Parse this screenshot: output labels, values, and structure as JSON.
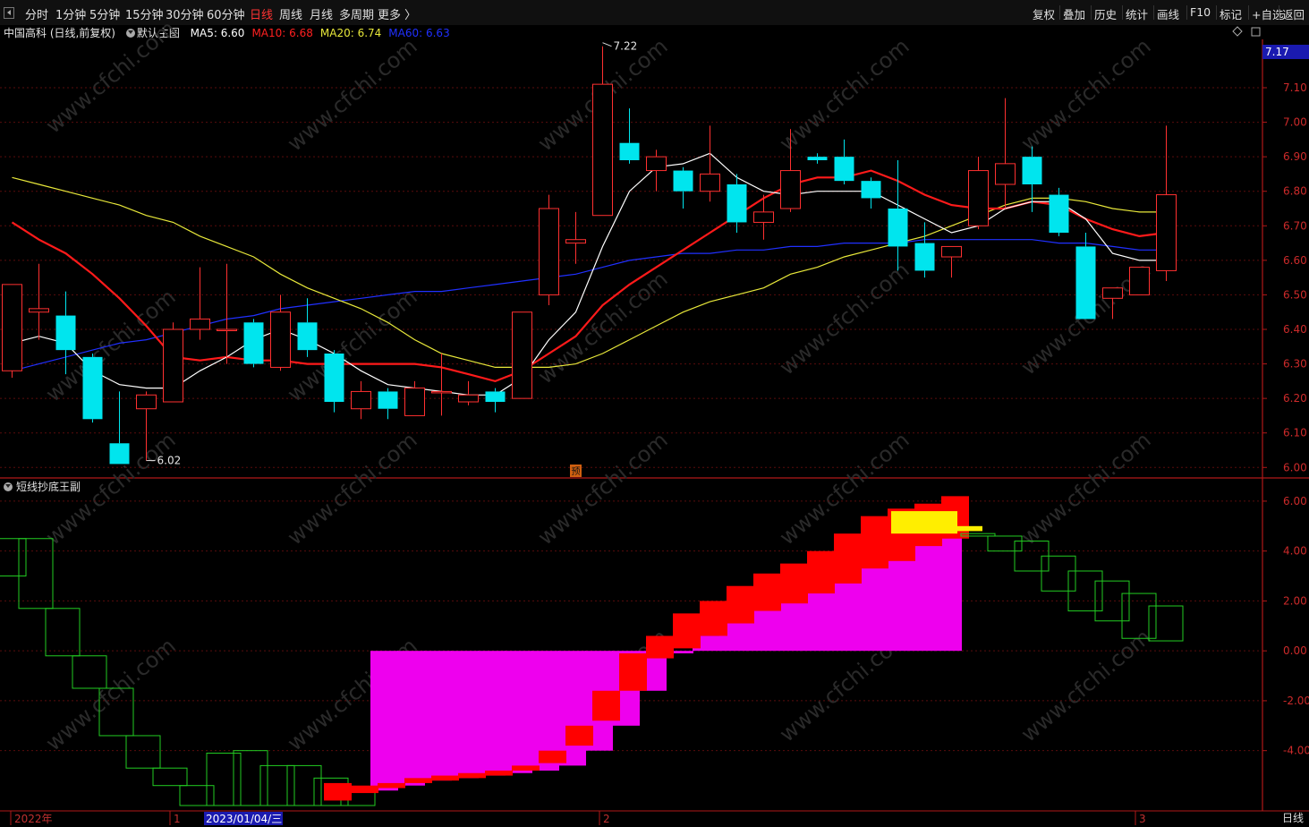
{
  "toolbar": {
    "periods": [
      {
        "label": "分时",
        "active": false
      },
      {
        "label": "1分钟",
        "active": false
      },
      {
        "label": "5分钟",
        "active": false
      },
      {
        "label": "15分钟",
        "active": false
      },
      {
        "label": "30分钟",
        "active": false
      },
      {
        "label": "60分钟",
        "active": false
      },
      {
        "label": "日线",
        "active": true
      },
      {
        "label": "周线",
        "active": false
      },
      {
        "label": "月线",
        "active": false
      },
      {
        "label": "多周期",
        "active": false
      },
      {
        "label": "更多 〉",
        "active": false
      }
    ],
    "right_buttons": [
      "复权",
      "叠加",
      "历史",
      "统计",
      "画线",
      "F10",
      "标记",
      "+自选",
      "返回"
    ]
  },
  "main": {
    "title": "中国高科 (日线,前复权)",
    "template": "默认主图",
    "ma_labels": [
      {
        "text": "MA5: 6.60",
        "color": "#ffffff"
      },
      {
        "text": "MA10: 6.68",
        "color": "#ff2020"
      },
      {
        "text": "MA20: 6.74",
        "color": "#e8e83a"
      },
      {
        "text": "MA60: 6.63",
        "color": "#2030ff"
      }
    ]
  },
  "sub": {
    "title": "短线抄底王副"
  },
  "period_label": "日线",
  "colors": {
    "up": "#ff3030",
    "down": "#00e5ee",
    "ma5": "#ffffff",
    "ma10": "#ff1a1a",
    "ma20": "#e8e83a",
    "ma60": "#2030ff",
    "axis": "#b01818",
    "green": "#22cc22",
    "magenta": "#ee00ee",
    "red": "#ff0000",
    "yellow": "#ffee00"
  },
  "watermark": "www.cfchi.com",
  "chart_data": [
    {
      "type": "candlestick",
      "ylim": [
        5.98,
        7.24
      ],
      "yticks": [
        "7.10",
        "7.00",
        "6.90",
        "6.80",
        "6.70",
        "6.60",
        "6.50",
        "6.40",
        "6.30",
        "6.20",
        "6.10",
        "6.00"
      ],
      "current_price": "7.17",
      "high_annotation": "7.22",
      "low_annotation": "6.02",
      "marker": "预",
      "candles": [
        {
          "o": 6.28,
          "c": 6.53,
          "h": 6.53,
          "l": 6.26
        },
        {
          "o": 6.45,
          "c": 6.46,
          "h": 6.59,
          "l": 6.37
        },
        {
          "o": 6.44,
          "c": 6.34,
          "h": 6.51,
          "l": 6.27
        },
        {
          "o": 6.32,
          "c": 6.14,
          "h": 6.33,
          "l": 6.13
        },
        {
          "o": 6.07,
          "c": 6.01,
          "h": 6.22,
          "l": 6.01
        },
        {
          "o": 6.17,
          "c": 6.21,
          "h": 6.22,
          "l": 6.02
        },
        {
          "o": 6.19,
          "c": 6.4,
          "h": 6.42,
          "l": 6.19
        },
        {
          "o": 6.4,
          "c": 6.43,
          "h": 6.58,
          "l": 6.37
        },
        {
          "o": 6.4,
          "c": 6.4,
          "h": 6.59,
          "l": 6.3
        },
        {
          "o": 6.42,
          "c": 6.3,
          "h": 6.43,
          "l": 6.29
        },
        {
          "o": 6.29,
          "c": 6.45,
          "h": 6.5,
          "l": 6.28
        },
        {
          "o": 6.42,
          "c": 6.34,
          "h": 6.49,
          "l": 6.32
        },
        {
          "o": 6.33,
          "c": 6.19,
          "h": 6.34,
          "l": 6.16
        },
        {
          "o": 6.17,
          "c": 6.22,
          "h": 6.25,
          "l": 6.14
        },
        {
          "o": 6.22,
          "c": 6.17,
          "h": 6.23,
          "l": 6.14
        },
        {
          "o": 6.15,
          "c": 6.23,
          "h": 6.25,
          "l": 6.15
        },
        {
          "o": 6.22,
          "c": 6.22,
          "h": 6.33,
          "l": 6.15
        },
        {
          "o": 6.19,
          "c": 6.21,
          "h": 6.25,
          "l": 6.18
        },
        {
          "o": 6.22,
          "c": 6.19,
          "h": 6.23,
          "l": 6.16
        },
        {
          "o": 6.2,
          "c": 6.45,
          "h": 6.45,
          "l": 6.2
        },
        {
          "o": 6.5,
          "c": 6.75,
          "h": 6.79,
          "l": 6.47
        },
        {
          "o": 6.65,
          "c": 6.66,
          "h": 6.74,
          "l": 6.59
        },
        {
          "o": 6.73,
          "c": 7.11,
          "h": 7.22,
          "l": 6.73
        },
        {
          "o": 6.94,
          "c": 6.89,
          "h": 7.04,
          "l": 6.88
        },
        {
          "o": 6.86,
          "c": 6.9,
          "h": 6.92,
          "l": 6.8
        },
        {
          "o": 6.86,
          "c": 6.8,
          "h": 6.87,
          "l": 6.75
        },
        {
          "o": 6.8,
          "c": 6.85,
          "h": 6.99,
          "l": 6.77
        },
        {
          "o": 6.82,
          "c": 6.71,
          "h": 6.85,
          "l": 6.68
        },
        {
          "o": 6.71,
          "c": 6.74,
          "h": 6.79,
          "l": 6.66
        },
        {
          "o": 6.75,
          "c": 6.86,
          "h": 6.98,
          "l": 6.74
        },
        {
          "o": 6.9,
          "c": 6.89,
          "h": 6.91,
          "l": 6.88
        },
        {
          "o": 6.9,
          "c": 6.83,
          "h": 6.95,
          "l": 6.82
        },
        {
          "o": 6.83,
          "c": 6.78,
          "h": 6.84,
          "l": 6.75
        },
        {
          "o": 6.75,
          "c": 6.64,
          "h": 6.89,
          "l": 6.57
        },
        {
          "o": 6.65,
          "c": 6.57,
          "h": 6.71,
          "l": 6.55
        },
        {
          "o": 6.61,
          "c": 6.64,
          "h": 6.64,
          "l": 6.55
        },
        {
          "o": 6.7,
          "c": 6.86,
          "h": 6.9,
          "l": 6.69
        },
        {
          "o": 6.82,
          "c": 6.88,
          "h": 7.07,
          "l": 6.75
        },
        {
          "o": 6.9,
          "c": 6.82,
          "h": 6.93,
          "l": 6.74
        },
        {
          "o": 6.79,
          "c": 6.68,
          "h": 6.81,
          "l": 6.67
        },
        {
          "o": 6.64,
          "c": 6.43,
          "h": 6.68,
          "l": 6.43
        },
        {
          "o": 6.49,
          "c": 6.52,
          "h": 6.52,
          "l": 6.43
        },
        {
          "o": 6.5,
          "c": 6.58,
          "h": 6.58,
          "l": 6.5
        },
        {
          "o": 6.57,
          "c": 6.79,
          "h": 6.99,
          "l": 6.54
        }
      ],
      "ma5": [
        6.36,
        6.38,
        6.36,
        6.28,
        6.24,
        6.23,
        6.23,
        6.28,
        6.32,
        6.37,
        6.4,
        6.37,
        6.33,
        6.28,
        6.24,
        6.23,
        6.22,
        6.21,
        6.21,
        6.26,
        6.37,
        6.45,
        6.64,
        6.8,
        6.87,
        6.88,
        6.91,
        6.84,
        6.8,
        6.79,
        6.8,
        6.8,
        6.8,
        6.76,
        6.72,
        6.68,
        6.7,
        6.75,
        6.77,
        6.77,
        6.72,
        6.62,
        6.6,
        6.6
      ],
      "ma10": [
        6.71,
        6.66,
        6.62,
        6.56,
        6.49,
        6.41,
        6.32,
        6.31,
        6.32,
        6.31,
        6.31,
        6.3,
        6.3,
        6.3,
        6.3,
        6.3,
        6.29,
        6.27,
        6.25,
        6.28,
        6.33,
        6.38,
        6.47,
        6.53,
        6.58,
        6.63,
        6.68,
        6.73,
        6.78,
        6.82,
        6.84,
        6.84,
        6.86,
        6.83,
        6.79,
        6.76,
        6.75,
        6.75,
        6.77,
        6.76,
        6.72,
        6.69,
        6.67,
        6.68
      ],
      "ma20": [
        6.84,
        6.82,
        6.8,
        6.78,
        6.76,
        6.73,
        6.71,
        6.67,
        6.64,
        6.61,
        6.56,
        6.52,
        6.49,
        6.46,
        6.42,
        6.37,
        6.33,
        6.31,
        6.29,
        6.29,
        6.29,
        6.3,
        6.33,
        6.37,
        6.41,
        6.45,
        6.48,
        6.5,
        6.52,
        6.56,
        6.58,
        6.61,
        6.63,
        6.65,
        6.67,
        6.7,
        6.73,
        6.76,
        6.78,
        6.78,
        6.77,
        6.75,
        6.74,
        6.74
      ],
      "ma60": [
        6.28,
        6.3,
        6.32,
        6.34,
        6.36,
        6.37,
        6.39,
        6.41,
        6.43,
        6.44,
        6.46,
        6.47,
        6.48,
        6.49,
        6.5,
        6.51,
        6.51,
        6.52,
        6.53,
        6.54,
        6.55,
        6.56,
        6.58,
        6.6,
        6.61,
        6.62,
        6.62,
        6.63,
        6.63,
        6.64,
        6.64,
        6.65,
        6.65,
        6.65,
        6.66,
        6.66,
        6.66,
        6.66,
        6.66,
        6.65,
        6.65,
        6.64,
        6.63,
        6.63
      ]
    },
    {
      "type": "bar",
      "title": "短线抄底王副",
      "ylim": [
        -6.2,
        6.5
      ],
      "yticks": [
        "6.00",
        "4.00",
        "2.00",
        "0.00",
        "-2.00",
        "-4.00"
      ],
      "green_boxes": [
        [
          4.5,
          3.0
        ],
        [
          1.7,
          4.5
        ],
        [
          -0.2,
          1.7
        ],
        [
          -1.5,
          -0.2
        ],
        [
          -3.4,
          -1.5
        ],
        [
          -4.7,
          -3.4
        ],
        [
          -5.4,
          -4.7
        ],
        [
          -6.2,
          -5.4
        ],
        [
          -6.2,
          -4.1
        ],
        [
          -6.2,
          -4.0
        ],
        [
          -6.2,
          -4.6
        ],
        [
          -6.2,
          -4.6
        ],
        [
          -6.2,
          -5.1
        ],
        [
          -6.2,
          -5.6
        ]
      ],
      "red_bars": [
        [
          -6.0,
          -5.3
        ],
        [
          -5.7,
          -5.4
        ],
        [
          -5.5,
          -5.3
        ],
        [
          -5.3,
          -5.1
        ],
        [
          -5.2,
          -5.0
        ],
        [
          -5.1,
          -4.9
        ],
        [
          -5.0,
          -4.8
        ],
        [
          -4.8,
          -4.6
        ],
        [
          -4.5,
          -4.0
        ],
        [
          -3.8,
          -3.0
        ],
        [
          -2.8,
          -1.6
        ],
        [
          -1.6,
          -0.1
        ],
        [
          -0.3,
          0.6
        ],
        [
          0.1,
          1.5
        ],
        [
          0.6,
          2.0
        ],
        [
          1.1,
          2.6
        ],
        [
          1.6,
          3.1
        ],
        [
          1.9,
          3.5
        ],
        [
          2.3,
          4.0
        ],
        [
          2.7,
          4.7
        ],
        [
          3.3,
          5.4
        ],
        [
          3.6,
          5.7
        ],
        [
          4.2,
          5.9
        ],
        [
          4.5,
          6.2
        ]
      ],
      "magenta_bars": [
        [
          -5.6,
          0
        ],
        [
          -5.4,
          0
        ],
        [
          -5.2,
          0
        ],
        [
          -5.1,
          0
        ],
        [
          -5.0,
          0
        ],
        [
          -4.9,
          0
        ],
        [
          -4.8,
          0
        ],
        [
          -4.6,
          0
        ],
        [
          -4.0,
          0
        ],
        [
          -3.0,
          0
        ],
        [
          -1.6,
          0
        ],
        [
          -0.1,
          0
        ],
        [
          0,
          0.6
        ],
        [
          0,
          1.5
        ],
        [
          0,
          2.0
        ],
        [
          0,
          2.6
        ],
        [
          0,
          3.1
        ],
        [
          0,
          3.5
        ],
        [
          0,
          4.0
        ],
        [
          0,
          4.4
        ],
        [
          0,
          4.6
        ],
        [
          0,
          4.6
        ]
      ],
      "yellow_bars": [
        [
          4.7,
          5.6
        ],
        [
          4.8,
          5.0
        ]
      ],
      "post_green_boxes": [
        [
          4.7,
          4.6
        ],
        [
          4.0,
          4.6
        ],
        [
          3.2,
          4.4
        ],
        [
          2.4,
          3.8
        ],
        [
          1.6,
          3.2
        ],
        [
          1.2,
          2.8
        ],
        [
          0.5,
          2.3
        ],
        [
          0.4,
          1.8
        ]
      ]
    }
  ],
  "xaxis": {
    "labels": [
      {
        "text": "2022年",
        "highlight": false
      },
      {
        "text": "1",
        "highlight": false
      },
      {
        "text": "2023/01/04/三",
        "highlight": true
      },
      {
        "text": "2",
        "highlight": false
      },
      {
        "text": "3",
        "highlight": false
      }
    ]
  }
}
